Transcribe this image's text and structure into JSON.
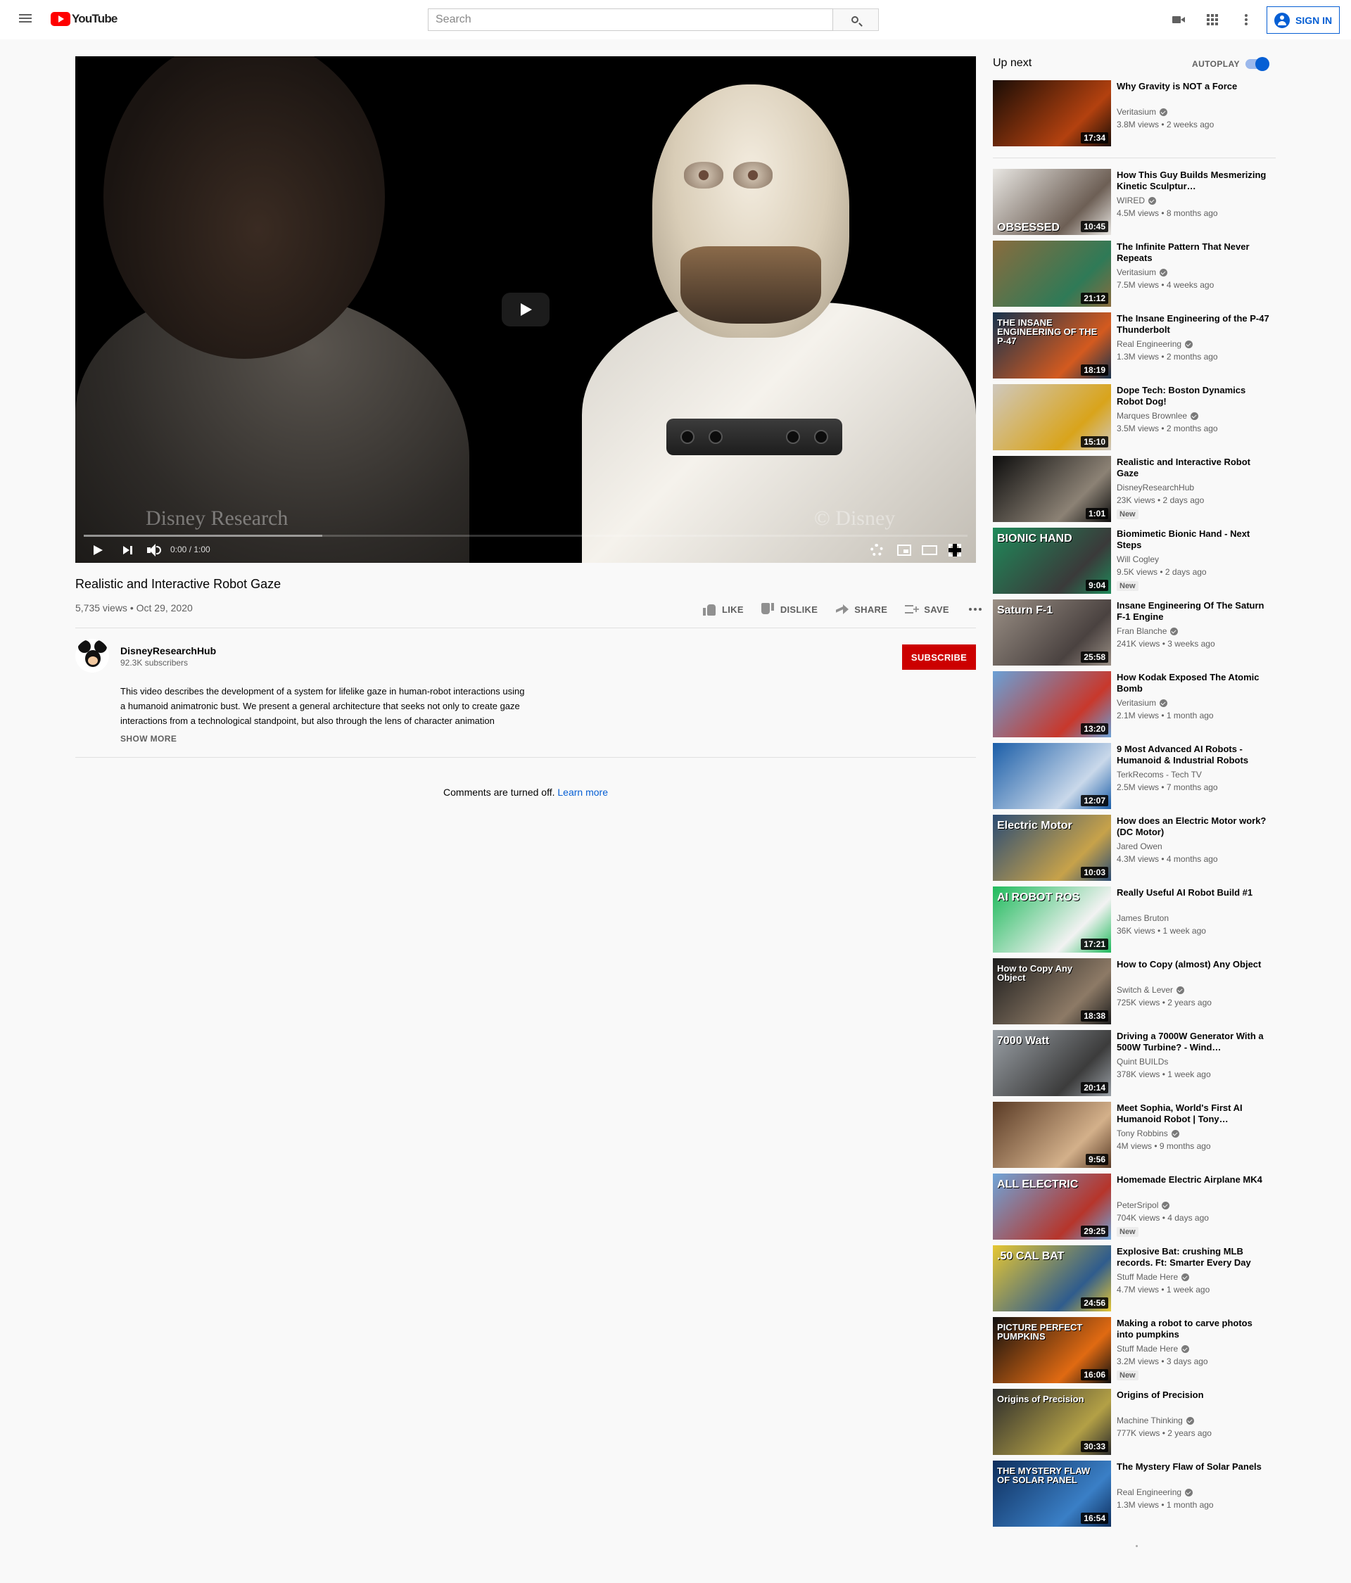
{
  "masthead": {
    "logo_text": "YouTube",
    "search_placeholder": "Search",
    "sign_in": "SIGN IN",
    "icons": [
      "menu-icon",
      "create-video-icon",
      "apps-icon",
      "settings-kebab-icon",
      "account-icon"
    ]
  },
  "player": {
    "watermark_left": "Disney Research",
    "watermark_right": "© Disney",
    "time": "0:00 / 1:00",
    "progress_loaded_fraction": 0.27
  },
  "video": {
    "title": "Realistic and Interactive Robot Gaze",
    "views": "5,735 views",
    "date": "Oct 29, 2020",
    "actions": {
      "like": "LIKE",
      "dislike": "DISLIKE",
      "share": "SHARE",
      "save": "SAVE"
    }
  },
  "channel": {
    "name": "DisneyResearchHub",
    "subscribers": "92.3K subscribers",
    "subscribe_label": "SUBSCRIBE"
  },
  "description": {
    "line1": "This video describes the development of a system for lifelike gaze in human-robot interactions using",
    "line2": "a humanoid animatronic bust. We present a general architecture that seeks not only to create gaze",
    "line3": "interactions from a technological standpoint, but also through the lens of character animation",
    "show_more": "SHOW MORE"
  },
  "comments": {
    "text": "Comments are turned off.",
    "link": "Learn more"
  },
  "sidebar": {
    "up_next": "Up next",
    "autoplay": "AUTOPLAY",
    "autoplay_on": true,
    "items": [
      {
        "title": "Why Gravity is NOT a Force",
        "channel": "Veritasium",
        "verified": true,
        "meta": "3.8M views • 2 weeks ago",
        "duration": "17:34",
        "badge": "",
        "caption": "",
        "colors": [
          "#1a0d06",
          "#b3410f"
        ]
      },
      {
        "title": "How This Guy Builds Mesmerizing Kinetic Sculptur…",
        "channel": "WIRED",
        "verified": true,
        "meta": "4.5M views • 8 months ago",
        "duration": "10:45",
        "badge": "",
        "caption": "OBSESSED",
        "colors": [
          "#e8e6e2",
          "#6d5f55"
        ]
      },
      {
        "title": "The Infinite Pattern That Never Repeats",
        "channel": "Veritasium",
        "verified": true,
        "meta": "7.5M views • 4 weeks ago",
        "duration": "21:12",
        "badge": "",
        "caption": "",
        "colors": [
          "#8a6c3e",
          "#2f7a57"
        ]
      },
      {
        "title": "The Insane Engineering of the P-47 Thunderbolt",
        "channel": "Real Engineering",
        "verified": true,
        "meta": "1.3M views • 2 months ago",
        "duration": "18:19",
        "badge": "",
        "caption": "THE INSANE ENGINEERING OF THE P-47",
        "colors": [
          "#16324d",
          "#d35a1f"
        ]
      },
      {
        "title": "Dope Tech: Boston Dynamics Robot Dog!",
        "channel": "Marques Brownlee",
        "verified": true,
        "meta": "3.5M views • 2 months ago",
        "duration": "15:10",
        "badge": "",
        "caption": "",
        "colors": [
          "#cfc8bd",
          "#d9a41b"
        ]
      },
      {
        "title": "Realistic and Interactive Robot Gaze",
        "channel": "DisneyResearchHub",
        "verified": false,
        "meta": "23K views • 2 days ago",
        "duration": "1:01",
        "badge": "New",
        "caption": "",
        "colors": [
          "#0d0d0d",
          "#8c8275"
        ]
      },
      {
        "title": "Biomimetic Bionic Hand - Next Steps",
        "channel": "Will Cogley",
        "verified": false,
        "meta": "9.5K views • 2 days ago",
        "duration": "9:04",
        "badge": "New",
        "caption": "BIONIC HAND",
        "colors": [
          "#1f8a5a",
          "#3a3a3a"
        ]
      },
      {
        "title": "Insane Engineering Of The Saturn F-1 Engine",
        "channel": "Fran Blanche",
        "verified": true,
        "meta": "241K views • 3 weeks ago",
        "duration": "25:58",
        "badge": "",
        "caption": "Saturn F-1",
        "colors": [
          "#9a8f85",
          "#4a4240"
        ]
      },
      {
        "title": "How Kodak Exposed The Atomic Bomb",
        "channel": "Veritasium",
        "verified": true,
        "meta": "2.1M views • 1 month ago",
        "duration": "13:20",
        "badge": "",
        "caption": "",
        "colors": [
          "#6aa0d6",
          "#c8382c"
        ]
      },
      {
        "title": "9 Most Advanced AI Robots - Humanoid & Industrial Robots",
        "channel": "TerkRecoms - Tech TV",
        "verified": false,
        "meta": "2.5M views • 7 months ago",
        "duration": "12:07",
        "badge": "",
        "caption": "",
        "colors": [
          "#1b5ea8",
          "#c9d8ea"
        ]
      },
      {
        "title": "How does an Electric Motor work? (DC Motor)",
        "channel": "Jared Owen",
        "verified": false,
        "meta": "4.3M views • 4 months ago",
        "duration": "10:03",
        "badge": "",
        "caption": "Electric Motor",
        "colors": [
          "#2b4c74",
          "#c7a24a"
        ]
      },
      {
        "title": "Really Useful AI Robot Build #1",
        "channel": "James Bruton",
        "verified": false,
        "meta": "36K views • 1 week ago",
        "duration": "17:21",
        "badge": "",
        "caption": "AI ROBOT ROS",
        "colors": [
          "#1fba5c",
          "#f2f2f2"
        ]
      },
      {
        "title": "How to Copy (almost) Any Object",
        "channel": "Switch & Lever",
        "verified": true,
        "meta": "725K views • 2 years ago",
        "duration": "18:38",
        "badge": "",
        "caption": "How to Copy Any Object",
        "colors": [
          "#1d1d1d",
          "#8d7a66"
        ]
      },
      {
        "title": "Driving a 7000W Generator With a 500W Turbine? - Wind…",
        "channel": "Quint BUILDs",
        "verified": false,
        "meta": "378K views • 1 week ago",
        "duration": "20:14",
        "badge": "",
        "caption": "7000 Watt",
        "colors": [
          "#9aa0a6",
          "#3c3c3c"
        ]
      },
      {
        "title": "Meet Sophia, World's First AI Humanoid Robot | Tony…",
        "channel": "Tony Robbins",
        "verified": true,
        "meta": "4M views • 9 months ago",
        "duration": "9:56",
        "badge": "",
        "caption": "",
        "colors": [
          "#5a3b26",
          "#d3b08a"
        ]
      },
      {
        "title": "Homemade Electric Airplane MK4",
        "channel": "PeterSripol",
        "verified": true,
        "meta": "704K views • 4 days ago",
        "duration": "29:25",
        "badge": "New",
        "caption": "ALL ELECTRIC",
        "colors": [
          "#6fa4d8",
          "#b6352b"
        ]
      },
      {
        "title": "Explosive Bat: crushing MLB records. Ft: Smarter Every Day",
        "channel": "Stuff Made Here",
        "verified": true,
        "meta": "4.7M views • 1 week ago",
        "duration": "24:56",
        "badge": "",
        "caption": ".50 CAL BAT",
        "colors": [
          "#e6c733",
          "#2f5c8d"
        ]
      },
      {
        "title": "Making a robot to carve photos into pumpkins",
        "channel": "Stuff Made Here",
        "verified": true,
        "meta": "3.2M views • 3 days ago",
        "duration": "16:06",
        "badge": "New",
        "caption": "PICTURE PERFECT PUMPKINS",
        "colors": [
          "#101010",
          "#e06a12"
        ]
      },
      {
        "title": "Origins of Precision",
        "channel": "Machine Thinking",
        "verified": true,
        "meta": "777K views • 2 years ago",
        "duration": "30:33",
        "badge": "",
        "caption": "Origins of Precision",
        "colors": [
          "#2c2c2c",
          "#b3a046"
        ]
      },
      {
        "title": "The Mystery Flaw of Solar Panels",
        "channel": "Real Engineering",
        "verified": true,
        "meta": "1.3M views • 1 month ago",
        "duration": "16:54",
        "badge": "",
        "caption": "THE MYSTERY FLAW OF SOLAR PANEL",
        "colors": [
          "#0e2e5c",
          "#3a7fc6"
        ]
      }
    ]
  }
}
